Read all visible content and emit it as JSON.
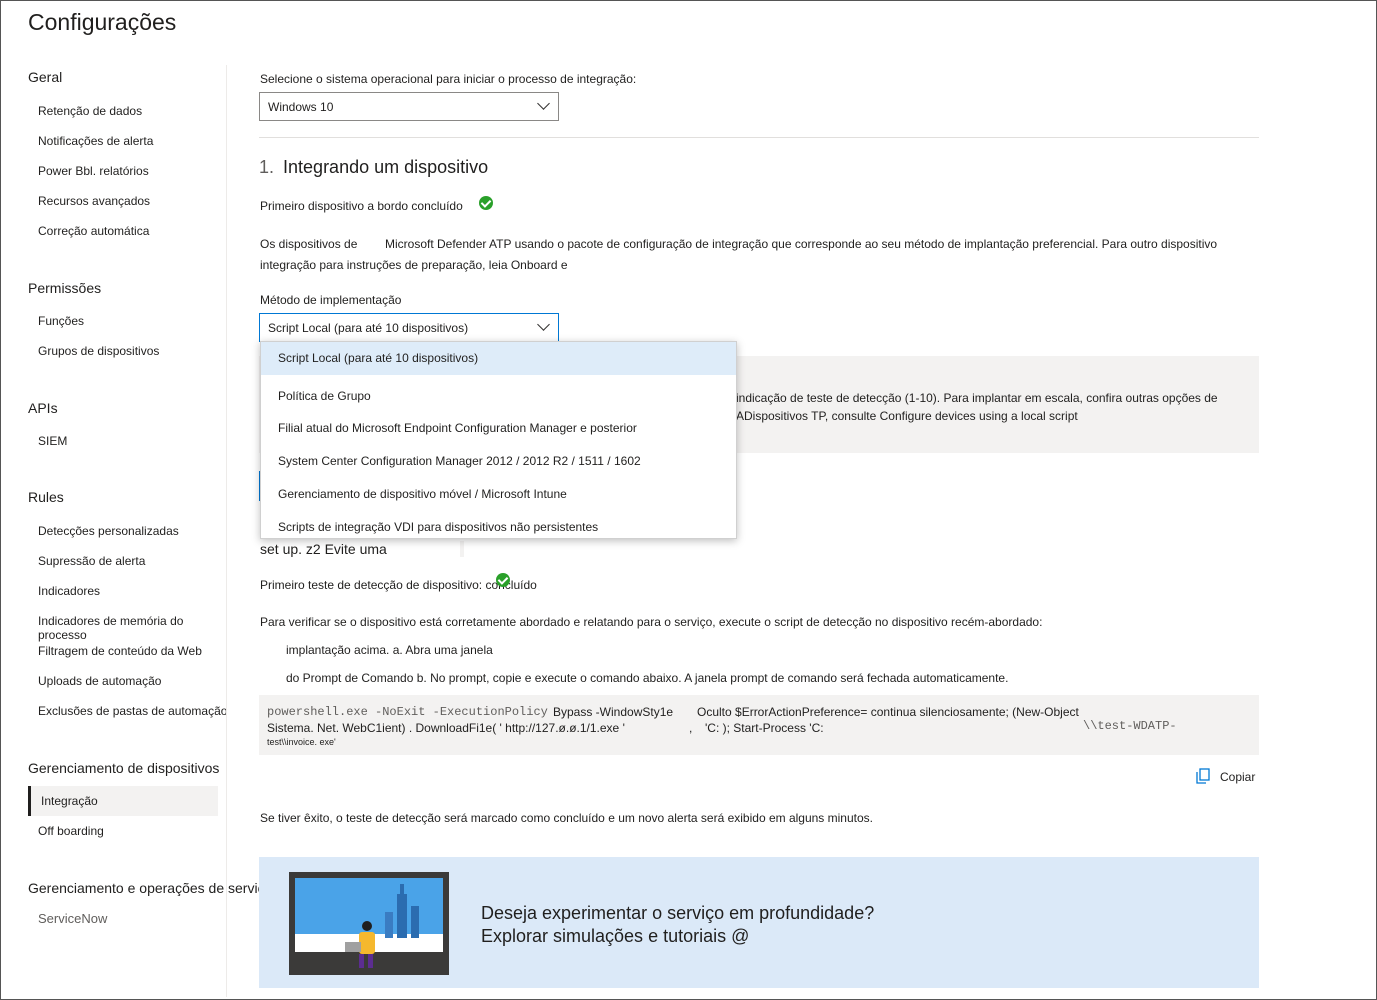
{
  "page": {
    "title": "Configurações"
  },
  "sidebar": {
    "sections": [
      {
        "heading": "Geral",
        "items": [
          "Retenção de dados",
          "Notificações de alerta",
          "Power Bbl. relatórios",
          "Recursos avançados",
          "Correção automática"
        ]
      },
      {
        "heading": "Permissões",
        "items": [
          "Funções",
          "Grupos de dispositivos"
        ]
      },
      {
        "heading": "APIs",
        "items": [
          "SIEM"
        ]
      },
      {
        "heading": "Rules",
        "items": [
          "Detecções personalizadas",
          "Supressão de alerta",
          "Indicadores",
          "Indicadores de memória do processo",
          "Filtragem de conteúdo da Web",
          "Uploads de automação",
          "Exclusões de pastas de automação"
        ]
      },
      {
        "heading": "Gerenciamento de dispositivos",
        "items": [
          "Integração",
          "Off boarding"
        ]
      },
      {
        "heading": "Gerenciamento e operações de serviços de TI",
        "items": [
          "ServiceNow"
        ]
      }
    ],
    "selected": "Integração"
  },
  "os": {
    "label": "Selecione o sistema operacional para iniciar o processo de integração:",
    "value": "Windows 10"
  },
  "step1": {
    "number": "1.",
    "title": "Integrando um dispositivo",
    "status": "Primeiro dispositivo a bordo concluído",
    "desc_part1": "Os dispositivos de",
    "desc_part2": "Microsoft Defender ATP usando o pacote de configuração de integração que corresponde ao seu método de implantação preferencial. Para outro dispositivo",
    "desc_line2": "integração para instruções de preparação, leia Onboard e"
  },
  "deploy": {
    "label": "Método de implementação",
    "value": "Script Local (para até 10 dispositivos)",
    "options": [
      "Script Local (para até 10 dispositivos)",
      "Política de Grupo",
      "Filial atual do Microsoft Endpoint Configuration Manager e posterior",
      "System Center Configuration Manager 2012 / 2012 R2 / 1511 / 1602",
      "Gerenciamento de dispositivo móvel / Microsoft Intune",
      "Scripts de integração VDI para dispositivos não persistentes"
    ]
  },
  "infobox": {
    "line1": "indicação de teste de detecção (1-10). Para implantar em escala, confira outras opções de",
    "line2": "ADispositivos TP, consulte Configure devices using a local script"
  },
  "step2": {
    "partial": "set up. z2 Evite uma",
    "status": "Primeiro teste de detecção de dispositivo: concluído",
    "instructions": "Para verificar se o dispositivo está corretamente abordado e relatando para o serviço, execute o script de detecção no dispositivo recém-abordado:",
    "sub1": "implantação acima. a. Abra uma janela",
    "sub2": "do Prompt de Comando b. No prompt, copie e execute o comando abaixo. A janela prompt de comando será fechada automaticamente."
  },
  "code": {
    "l1a": "powershell.exe -NoExit -ExecutionPolicy",
    "l1b": "Bypass -WindowSty1e",
    "l1c": "Oculto $ErrorActionPreference= continua silenciosamente; (New-Object",
    "l2a": "Sistema. Net. WebC1ient) . DownloadFi1e( ' http://127.ø.ø.1/1.exe '",
    "l2b": ",",
    "l2c": "'C: ); Start-Process 'C:",
    "l2d": "\\\\test-WDATP-",
    "l3": "test\\\\invoice. exe'"
  },
  "copy": {
    "label": "Copiar"
  },
  "success_note": "Se tiver êxito, o teste de detecção será marcado como concluído e um novo alerta será exibido em alguns minutos.",
  "banner": {
    "line1": "Deseja experimentar o serviço em profundidade?",
    "line2": "Explorar simulações e tutoriais @"
  },
  "colors": {
    "accent": "#0078d4",
    "success": "#2aa02a",
    "banner_bg": "#dbe9f8"
  }
}
